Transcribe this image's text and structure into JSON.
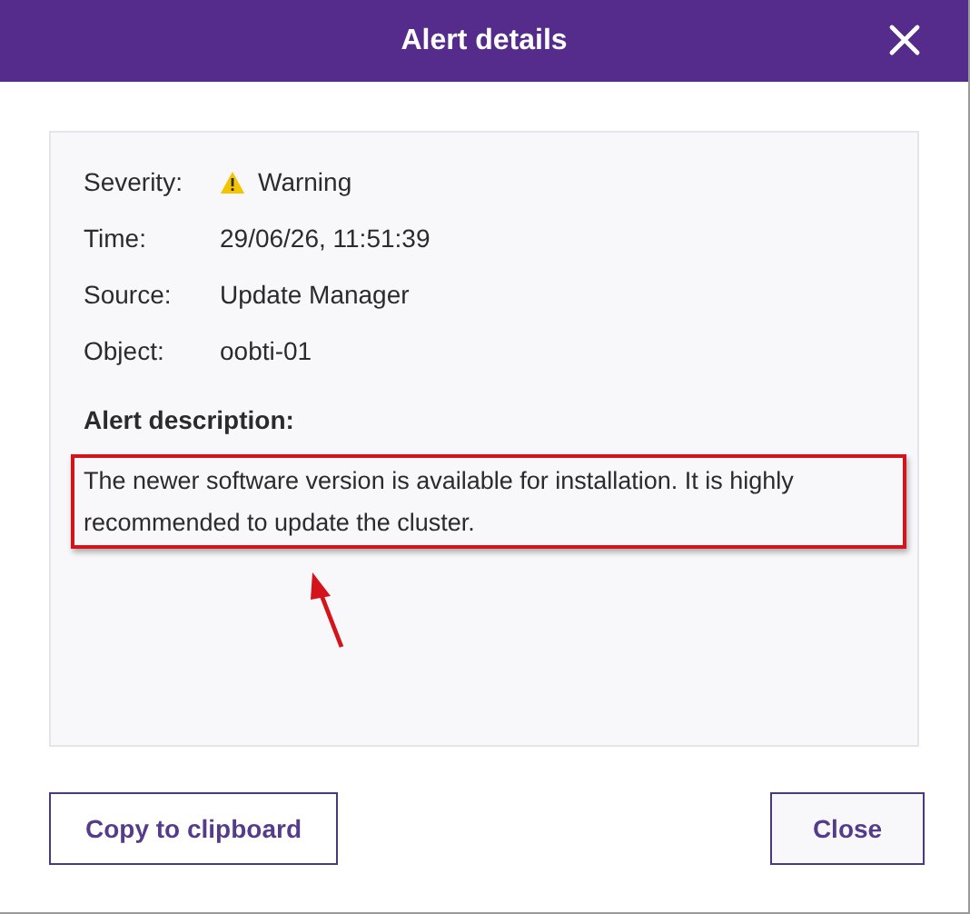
{
  "window": {
    "title": "Alert details"
  },
  "details": [
    {
      "label": "Severity:",
      "value": "Warning",
      "kind": "severity"
    },
    {
      "label": "Time:",
      "value": "29/06/26, 11:51:39",
      "kind": "text"
    },
    {
      "label": "Source:",
      "value": "Update Manager",
      "kind": "text"
    },
    {
      "label": "Object:",
      "value": "oobti-01",
      "kind": "text"
    }
  ],
  "description": {
    "label": "Alert description:",
    "text": "The newer software version is available for installation. It is highly recommended to update the cluster."
  },
  "buttons": [
    "Copy to clipboard",
    "Close"
  ]
}
